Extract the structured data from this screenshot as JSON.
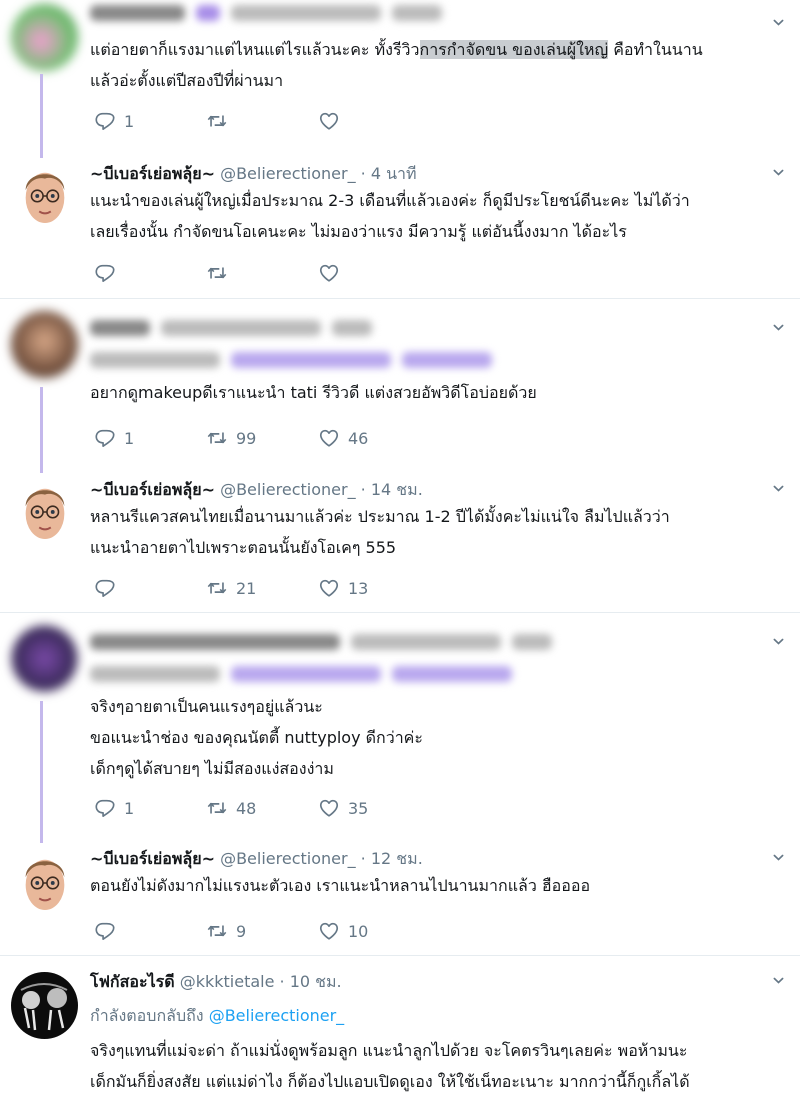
{
  "tweets": [
    {
      "author": "",
      "body_lines": [],
      "body_pre": "แต่อายตาก็แรงมาแต่ไหนแต่ไรแล้วนะคะ ทั้งรีวิว",
      "body_highlight": "การกำจัดขน ของเล่นผู้ใหญ่",
      "body_post": " คือทำในนาน",
      "body_line2": "แล้วอ่ะตั้งแต่ปีสองปีที่ผ่านมา",
      "replies": "1",
      "retweets": "",
      "likes": ""
    },
    {
      "author": "~บีเบอร์เย่อพลุ้ย~",
      "handle": "@Belierectioner_",
      "time": "· 4 นาที",
      "body_lines": [
        "แนะนำของเล่นผู้ใหญ่เมื่อประมาณ 2-3 เดือนที่แล้วเองค่ะ ก็ดูมีประโยชน์ดีนะคะ ไม่ได้ว่า",
        "เลยเรื่องนั้น กำจัดขนโอเคนะคะ ไม่มองว่าแรง มีความรู้ แต่อันนี้งงมาก ได้อะไร"
      ],
      "replies": "",
      "retweets": "",
      "likes": ""
    },
    {
      "author": "",
      "body_lines": [
        "อยากดูmakeupดีเราแนะนำ tati รีวิวดี แต่งสวยอัพวิดีโอบ่อยด้วย"
      ],
      "replies": "1",
      "retweets": "99",
      "likes": "46"
    },
    {
      "author": "~บีเบอร์เย่อพลุ้ย~",
      "handle": "@Belierectioner_",
      "time": "· 14 ชม.",
      "body_lines": [
        "หลานรีแควสคนไทยเมื่อนานมาแล้วค่ะ ประมาณ 1-2 ปีได้มั้งคะไม่แน่ใจ ลืมไปแล้วว่า",
        "แนะนำอายตาไปเพราะตอนนั้นยังโอเคๆ 555"
      ],
      "replies": "",
      "retweets": "21",
      "likes": "13"
    },
    {
      "author": "",
      "body_lines": [
        "จริงๆอายตาเป็นคนแรงๆอยู่แล้วนะ",
        "ขอแนะนำช่อง ของคุณนัตตี้ nuttyploy ดีกว่าค่ะ",
        "เด็กๆดูได้สบายๆ ไม่มีสองแง่สองง่าม"
      ],
      "replies": "1",
      "retweets": "48",
      "likes": "35"
    },
    {
      "author": "~บีเบอร์เย่อพลุ้ย~",
      "handle": "@Belierectioner_",
      "time": "· 12 ชม.",
      "body_lines": [
        "ตอนยังไม่ดังมากไม่แรงนะตัวเอง เราแนะนำหลานไปนานมากแล้ว ฮืออออ"
      ],
      "replies": "",
      "retweets": "9",
      "likes": "10"
    },
    {
      "author": "โฟกัสอะไรดี",
      "handle": "@kkktietale",
      "time": "· 10 ชม.",
      "reply_prefix": "กำลังตอบกลับถึง",
      "reply_mention": "@Belierectioner_",
      "body_lines": [
        "จริงๆแทนที่แม่จะด่า ถ้าแม่นั่งดูพร้อมลูก แนะนำลูกไปด้วย จะโคตรวินๆเลยค่ะ พอห้ามนะ",
        "เด็กมันก็ยิ่งสงสัย แต่แม่ด่าไง ก็ต้องไปแอบเปิดดูเอง ให้ใช้เน็ทอะเนาะ มากกว่านี้ก็กูเกิ้ลได้"
      ]
    }
  ],
  "colors": {
    "thread_line": "#c4b8ec",
    "mention": "#1da1f2",
    "secondary_text": "#657786",
    "highlight": "#c9cdd1"
  },
  "icons": [
    "chevron-down-icon",
    "reply-icon",
    "retweet-icon",
    "like-icon"
  ]
}
